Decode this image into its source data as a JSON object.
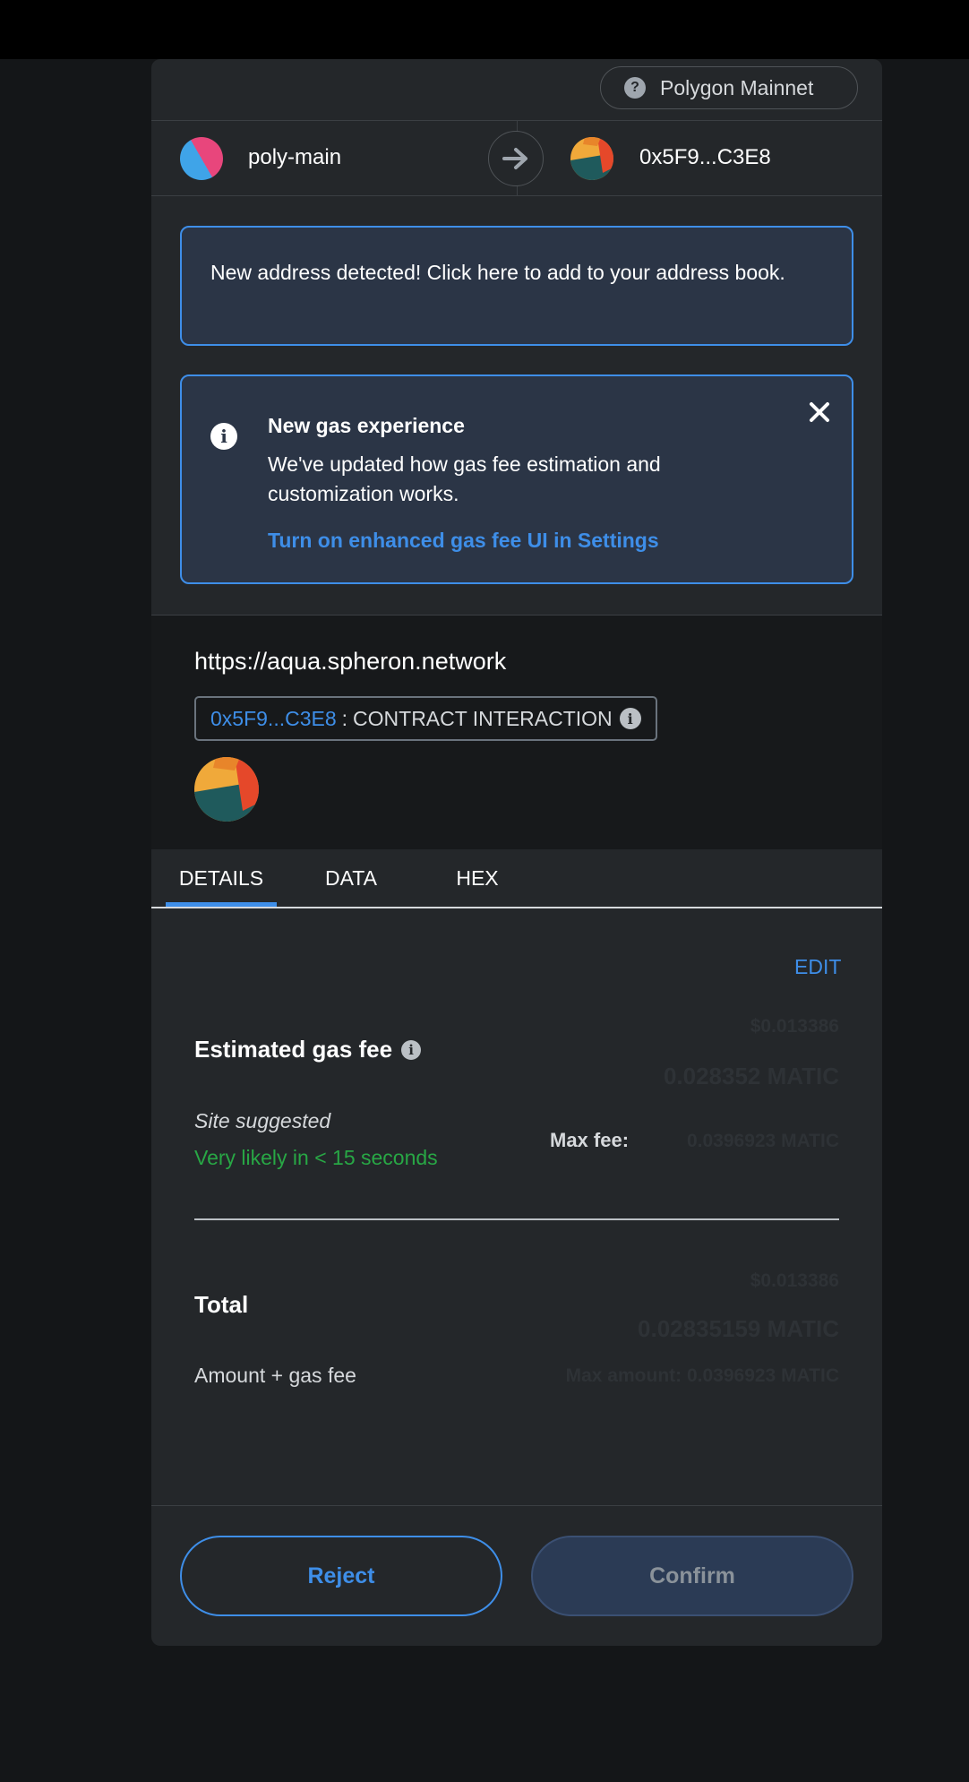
{
  "network": {
    "label": "Polygon Mainnet",
    "icon": "question-icon"
  },
  "sender": {
    "name": "poly-main"
  },
  "recipient": {
    "name": "0x5F9...C3E8"
  },
  "banners": {
    "address_detected": "New address detected! Click here to add to your address book.",
    "gas_title": "New gas experience",
    "gas_body": "We've updated how gas fee estimation and customization works.",
    "gas_link": "Turn on enhanced gas fee UI in Settings"
  },
  "origin": {
    "url": "https://aqua.spheron.network",
    "contract_address": "0x5F9...C3E8",
    "separator": ":",
    "interaction_label": "CONTRACT INTERACTION"
  },
  "tabs": [
    {
      "label": "DETAILS",
      "active": true
    },
    {
      "label": "DATA",
      "active": false
    },
    {
      "label": "HEX",
      "active": false
    }
  ],
  "details": {
    "edit_label": "EDIT",
    "estimated_gas_fee_label": "Estimated gas fee",
    "gas_fee_fiat": "$0.013386",
    "gas_fee_native": "0.028352 MATIC",
    "site_suggested": "Site suggested",
    "likelihood": "Very likely in < 15 seconds",
    "max_fee_label": "Max fee:",
    "max_fee_value": "0.0396923 MATIC",
    "total_label": "Total",
    "total_fiat": "$0.013386",
    "total_native": "0.02835159 MATIC",
    "amount_plus_gas": "Amount + gas fee",
    "max_amount": "Max amount: 0.0396923 MATIC"
  },
  "footer": {
    "reject_label": "Reject",
    "confirm_label": "Confirm"
  },
  "colors": {
    "accent": "#3e8ee8",
    "success": "#28a745",
    "background": "#24272a",
    "banner": "#2b3546"
  }
}
